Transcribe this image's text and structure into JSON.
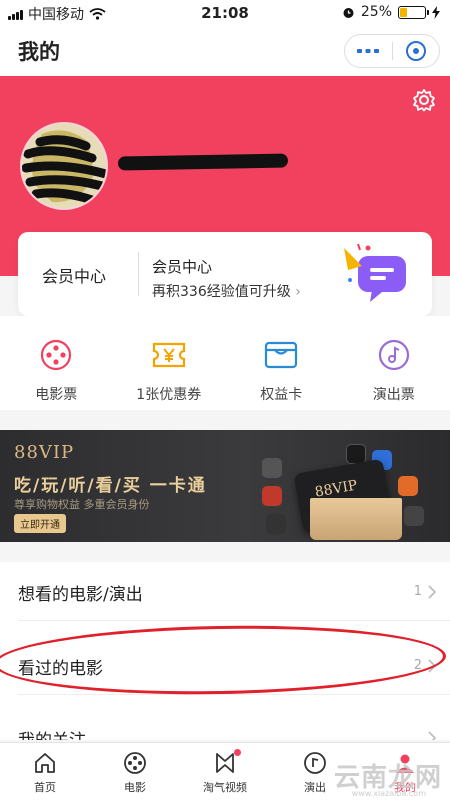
{
  "status_bar": {
    "carrier": "中国移动",
    "time": "21:08",
    "battery": "25%",
    "battery_level": 0.25
  },
  "header": {
    "title": "我的"
  },
  "member": {
    "left_label": "会员中心",
    "title": "会员中心",
    "subtitle": "再积336经验值可升级",
    "chevron": "›"
  },
  "quick_actions": [
    {
      "label": "电影票",
      "icon": "film-reel-icon"
    },
    {
      "label": "1张优惠券",
      "icon": "coupon-icon"
    },
    {
      "label": "权益卡",
      "icon": "card-icon"
    },
    {
      "label": "演出票",
      "icon": "music-disc-icon"
    }
  ],
  "banner": {
    "brand": "88VIP",
    "headline": "吃/玩/听/看/买 一卡通",
    "subline": "尊享购物权益 多重会员身份",
    "cta": "立即开通",
    "card_text": "88VIP"
  },
  "list": [
    {
      "label": "想看的电影/演出",
      "count": "1"
    },
    {
      "label": "看过的电影",
      "count": "2"
    },
    {
      "label": "我的关注",
      "count": ""
    }
  ],
  "tabs": [
    {
      "label": "首页",
      "icon": "home-icon"
    },
    {
      "label": "电影",
      "icon": "film-icon"
    },
    {
      "label": "淘气视频",
      "icon": "video-icon"
    },
    {
      "label": "演出",
      "icon": "show-icon"
    },
    {
      "label": "我的",
      "icon": "profile-icon"
    }
  ],
  "watermark": {
    "text": "云南龙网",
    "url": "www.xiazaiba.com"
  },
  "colors": {
    "accent": "#f2415e",
    "annotation": "#e0202a",
    "gold": "#e9cf9b",
    "purple": "#8b5cf6"
  }
}
